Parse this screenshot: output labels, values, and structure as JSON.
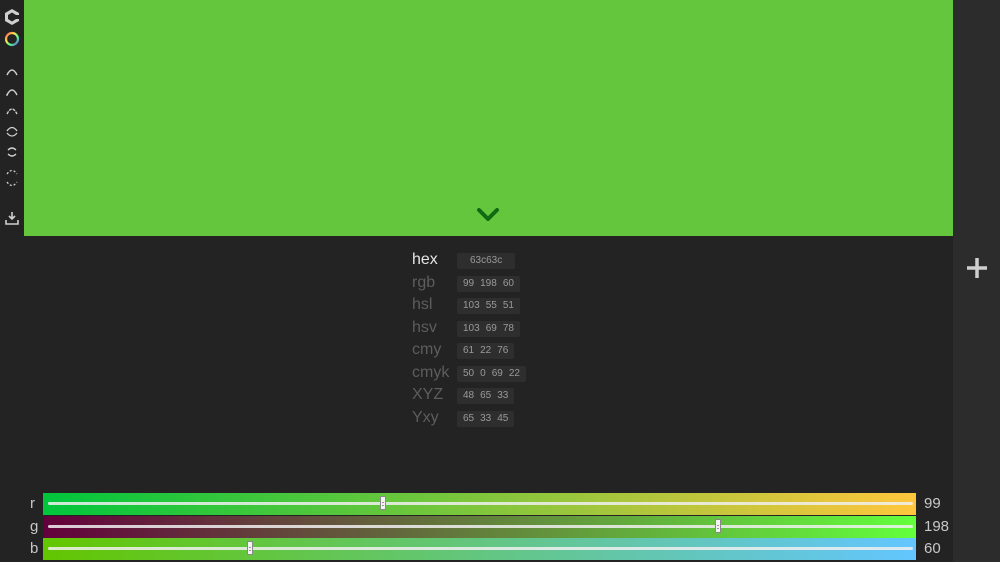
{
  "color": {
    "hex_color": "#63c63c",
    "chevron_color": "#0f6b12"
  },
  "toolbar": {
    "icons": [
      "logo-icon",
      "color-wheel-icon",
      "arc-icon",
      "arc-icon",
      "arc-icon",
      "arc-icon",
      "arc-icon",
      "arc-icon",
      "download-icon"
    ]
  },
  "formats": [
    {
      "label": "hex",
      "values": [
        "63c63c"
      ],
      "active": true
    },
    {
      "label": "rgb",
      "values": [
        "99",
        "198",
        "60"
      ]
    },
    {
      "label": "hsl",
      "values": [
        "103",
        "55",
        "51"
      ]
    },
    {
      "label": "hsv",
      "values": [
        "103",
        "69",
        "78"
      ]
    },
    {
      "label": "cmy",
      "values": [
        "61",
        "22",
        "76"
      ]
    },
    {
      "label": "cmyk",
      "values": [
        "50",
        "0",
        "69",
        "22"
      ]
    },
    {
      "label": "XYZ",
      "values": [
        "48",
        "65",
        "33"
      ]
    },
    {
      "label": "Yxy",
      "values": [
        "65",
        "33",
        "45"
      ]
    }
  ],
  "sliders": [
    {
      "label": "r",
      "value": "99",
      "fraction": 0.388,
      "gradient": [
        "#00c63c",
        "#ffc63c"
      ]
    },
    {
      "label": "g",
      "value": "198",
      "fraction": 0.776,
      "gradient": [
        "#63003c",
        "#63ff3c"
      ]
    },
    {
      "label": "b",
      "value": "60",
      "fraction": 0.235,
      "gradient": [
        "#63c600",
        "#63c6ff"
      ]
    }
  ]
}
